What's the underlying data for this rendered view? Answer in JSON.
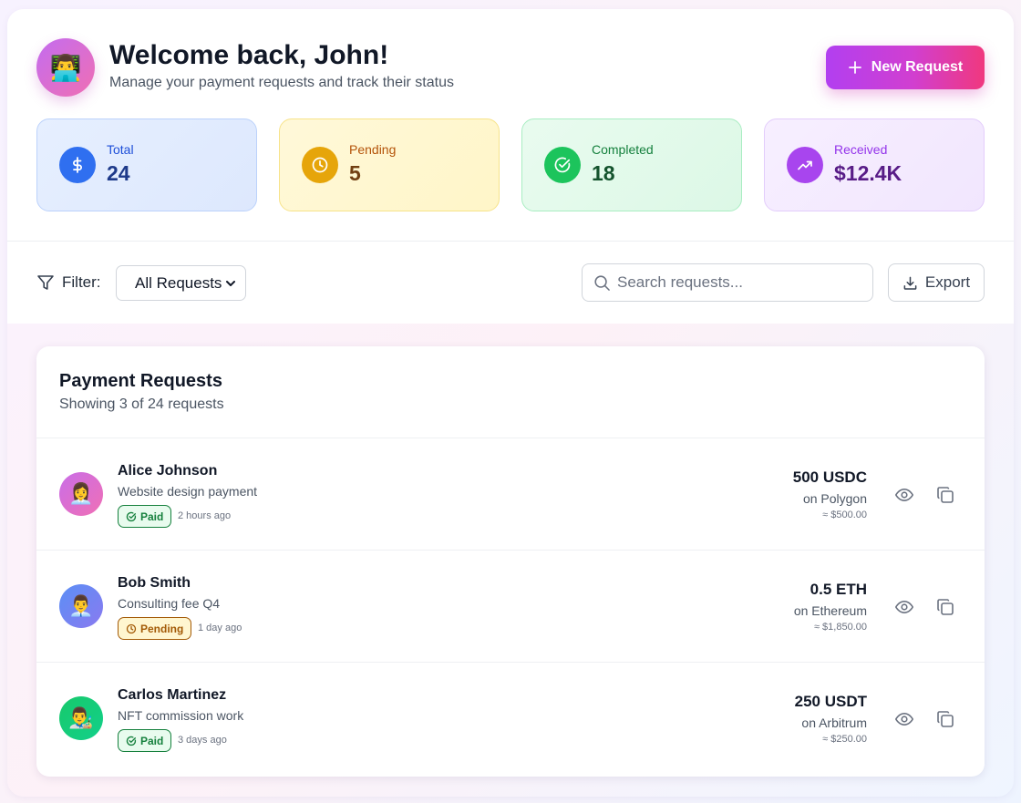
{
  "header": {
    "avatar_emoji": "👨‍💻",
    "title": "Welcome back, John!",
    "subtitle": "Manage your payment requests and track their status",
    "new_request_label": "New Request"
  },
  "stats": {
    "total": {
      "label": "Total",
      "value": "24",
      "icon": "dollar-icon",
      "color": "#2f6ff0"
    },
    "pending": {
      "label": "Pending",
      "value": "5",
      "icon": "clock-icon",
      "color": "#e6a50a"
    },
    "completed": {
      "label": "Completed",
      "value": "18",
      "icon": "check-circle-icon",
      "color": "#1cc45c"
    },
    "received": {
      "label": "Received",
      "value": "$12.4K",
      "icon": "trending-up-icon",
      "color": "#a845ee"
    }
  },
  "toolbar": {
    "filter_label": "Filter:",
    "filter_selected": "All Requests",
    "search_placeholder": "Search requests...",
    "export_label": "Export"
  },
  "requests": {
    "title": "Payment Requests",
    "subtitle": "Showing 3 of 24 requests",
    "items": [
      {
        "avatar_emoji": "👩‍💼",
        "name": "Alice Johnson",
        "description": "Website design payment",
        "status": "Paid",
        "time": "2 hours ago",
        "amount": "500 USDC",
        "network": "on Polygon",
        "usd": "≈ $500.00"
      },
      {
        "avatar_emoji": "👨‍💼",
        "name": "Bob Smith",
        "description": "Consulting fee Q4",
        "status": "Pending",
        "time": "1 day ago",
        "amount": "0.5 ETH",
        "network": "on Ethereum",
        "usd": "≈ $1,850.00"
      },
      {
        "avatar_emoji": "👨‍🎨",
        "name": "Carlos Martinez",
        "description": "NFT commission work",
        "status": "Paid",
        "time": "3 days ago",
        "amount": "250 USDT",
        "network": "on Arbitrum",
        "usd": "≈ $250.00"
      }
    ]
  }
}
